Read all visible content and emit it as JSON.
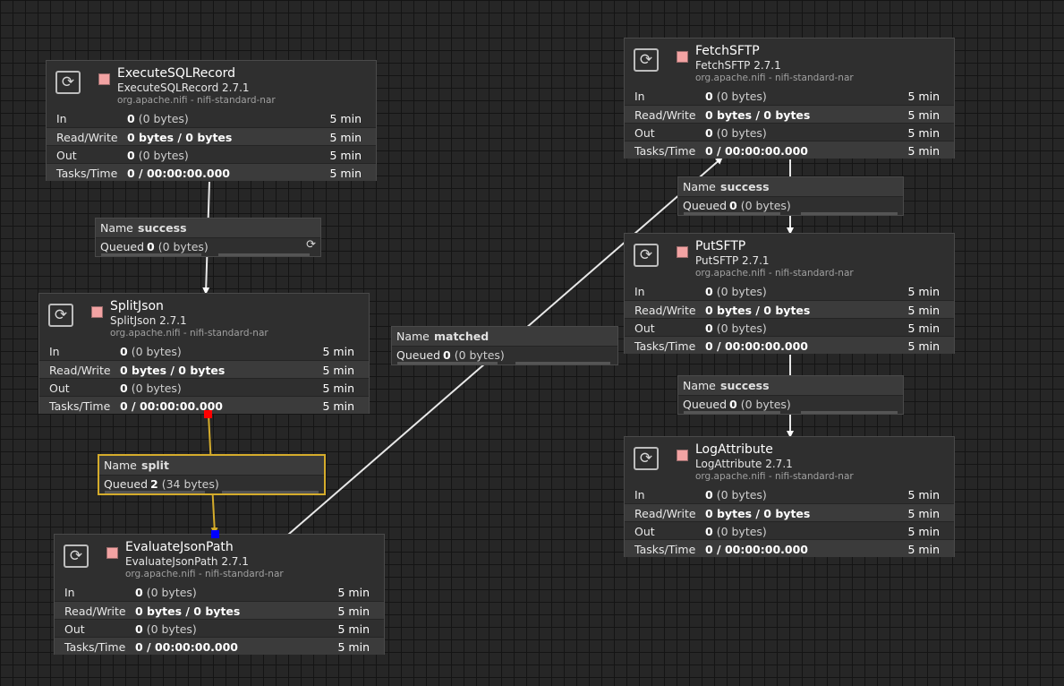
{
  "processors": [
    {
      "id": "executesqlrecord",
      "name": "ExecuteSQLRecord",
      "version": "ExecuteSQLRecord 2.7.1",
      "bundle": "org.apache.nifi - nifi-standard-nar",
      "icon": "processor-icon",
      "stats": {
        "in_label": "In",
        "in_count": "0",
        "in_bytes": "(0 bytes)",
        "in_time": "5 min",
        "rw_label": "Read/Write",
        "rw_value": "0 bytes / 0 bytes",
        "rw_time": "5 min",
        "out_label": "Out",
        "out_count": "0",
        "out_bytes": "(0 bytes)",
        "out_time": "5 min",
        "tasks_label": "Tasks/Time",
        "tasks_value": "0 / 00:00:00.000",
        "tasks_time": "5 min"
      }
    },
    {
      "id": "splitjson",
      "name": "SplitJson",
      "version": "SplitJson 2.7.1",
      "bundle": "org.apache.nifi - nifi-standard-nar",
      "icon": "processor-icon",
      "stats": {
        "in_label": "In",
        "in_count": "0",
        "in_bytes": "(0 bytes)",
        "in_time": "5 min",
        "rw_label": "Read/Write",
        "rw_value": "0 bytes / 0 bytes",
        "rw_time": "5 min",
        "out_label": "Out",
        "out_count": "0",
        "out_bytes": "(0 bytes)",
        "out_time": "5 min",
        "tasks_label": "Tasks/Time",
        "tasks_value": "0 / 00:00:00.000",
        "tasks_time": "5 min"
      }
    },
    {
      "id": "evaluatejsonpath",
      "name": "EvaluateJsonPath",
      "version": "EvaluateJsonPath 2.7.1",
      "bundle": "org.apache.nifi - nifi-standard-nar",
      "icon": "processor-icon",
      "stats": {
        "in_label": "In",
        "in_count": "0",
        "in_bytes": "(0 bytes)",
        "in_time": "5 min",
        "rw_label": "Read/Write",
        "rw_value": "0 bytes / 0 bytes",
        "rw_time": "5 min",
        "out_label": "Out",
        "out_count": "0",
        "out_bytes": "(0 bytes)",
        "out_time": "5 min",
        "tasks_label": "Tasks/Time",
        "tasks_value": "0 / 00:00:00.000",
        "tasks_time": "5 min"
      }
    },
    {
      "id": "fetchsftp",
      "name": "FetchSFTP",
      "version": "FetchSFTP 2.7.1",
      "bundle": "org.apache.nifi - nifi-standard-nar",
      "icon": "processor-icon",
      "stats": {
        "in_label": "In",
        "in_count": "0",
        "in_bytes": "(0 bytes)",
        "in_time": "5 min",
        "rw_label": "Read/Write",
        "rw_value": "0 bytes / 0 bytes",
        "rw_time": "5 min",
        "out_label": "Out",
        "out_count": "0",
        "out_bytes": "(0 bytes)",
        "out_time": "5 min",
        "tasks_label": "Tasks/Time",
        "tasks_value": "0 / 00:00:00.000",
        "tasks_time": "5 min"
      }
    },
    {
      "id": "putsftp",
      "name": "PutSFTP",
      "version": "PutSFTP 2.7.1",
      "bundle": "org.apache.nifi - nifi-standard-nar",
      "icon": "processor-icon",
      "stats": {
        "in_label": "In",
        "in_count": "0",
        "in_bytes": "(0 bytes)",
        "in_time": "5 min",
        "rw_label": "Read/Write",
        "rw_value": "0 bytes / 0 bytes",
        "rw_time": "5 min",
        "out_label": "Out",
        "out_count": "0",
        "out_bytes": "(0 bytes)",
        "out_time": "5 min",
        "tasks_label": "Tasks/Time",
        "tasks_value": "0 / 00:00:00.000",
        "tasks_time": "5 min"
      }
    },
    {
      "id": "logattribute",
      "name": "LogAttribute",
      "version": "LogAttribute 2.7.1",
      "bundle": "org.apache.nifi - nifi-standard-nar",
      "icon": "processor-icon",
      "stats": {
        "in_label": "In",
        "in_count": "0",
        "in_bytes": "(0 bytes)",
        "in_time": "5 min",
        "rw_label": "Read/Write",
        "rw_value": "0 bytes / 0 bytes",
        "rw_time": "5 min",
        "out_label": "Out",
        "out_count": "0",
        "out_bytes": "(0 bytes)",
        "out_time": "5 min",
        "tasks_label": "Tasks/Time",
        "tasks_value": "0 / 00:00:00.000",
        "tasks_time": "5 min"
      }
    }
  ],
  "connections": [
    {
      "id": "sql-success",
      "name_label": "Name",
      "name": "success",
      "queued_label": "Queued",
      "queued_count": "0",
      "queued_bytes": "(0 bytes)",
      "icon": "refresh-icon"
    },
    {
      "id": "split",
      "name_label": "Name",
      "name": "split",
      "queued_label": "Queued",
      "queued_count": "2",
      "queued_bytes": "(34 bytes)",
      "selected": true
    },
    {
      "id": "matched",
      "name_label": "Name",
      "name": "matched",
      "queued_label": "Queued",
      "queued_count": "0",
      "queued_bytes": "(0 bytes)"
    },
    {
      "id": "fetch-success",
      "name_label": "Name",
      "name": "success",
      "queued_label": "Queued",
      "queued_count": "0",
      "queued_bytes": "(0 bytes)"
    },
    {
      "id": "put-success",
      "name_label": "Name",
      "name": "success",
      "queued_label": "Queued",
      "queued_count": "0",
      "queued_bytes": "(0 bytes)"
    }
  ],
  "colors": {
    "canvas": "#262626",
    "edge": "#e8e8e8",
    "selected_edge": "#d5ac2b",
    "status_stopped": "#f2a3a3",
    "source_handle": "#ff0000",
    "target_handle": "#0000ff"
  }
}
